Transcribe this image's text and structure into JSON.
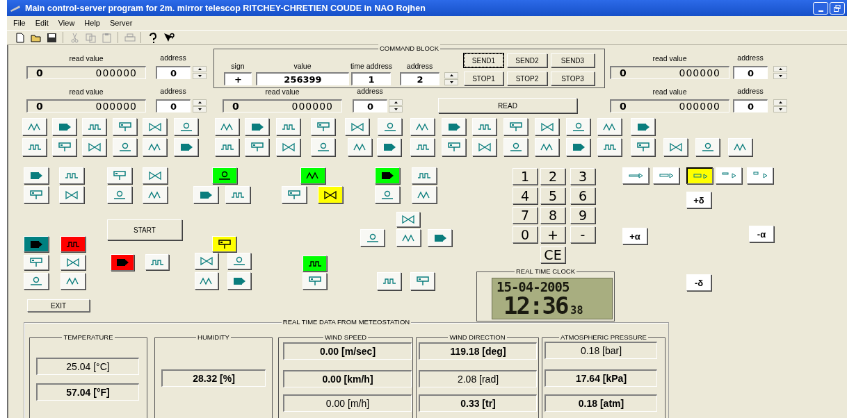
{
  "window": {
    "title": "Main control-server program for 2m. mirror telescop RITCHEY-CHRETIEN COUDE in NAO Rojhen"
  },
  "menu": [
    "File",
    "Edit",
    "View",
    "Help",
    "Server"
  ],
  "toolbar": [
    {
      "disabled": false
    },
    {
      "disabled": false
    },
    {
      "disabled": false
    },
    {
      "disabled": true
    },
    {
      "disabled": true
    },
    {
      "disabled": true
    },
    {
      "disabled": true
    },
    {
      "disabled": false
    },
    {
      "disabled": false
    }
  ],
  "readouts": [
    {
      "label": "read value",
      "sign": "0",
      "value": "000000",
      "address_label": "address",
      "address": "0"
    },
    {
      "label": "read value",
      "sign": "0",
      "value": "000000",
      "address_label": "address",
      "address": "0"
    },
    {
      "label": "read value",
      "sign": "0",
      "value": "000000",
      "address_label": "address",
      "address": "0"
    },
    {
      "label": "read value",
      "sign": "0",
      "value": "000000",
      "address_label": "address",
      "address": "0"
    },
    {
      "label": "read value",
      "sign": "0",
      "value": "000000",
      "address_label": "address",
      "address": "0"
    }
  ],
  "command_block": {
    "title": "COMMAND BLOCK",
    "sign_label": "sign",
    "sign": "+",
    "value_label": "value",
    "value": "256399",
    "time_address_label": "time address",
    "time_address": "1",
    "address_label": "address",
    "address": "2",
    "send_buttons": [
      {
        "label": "SEND1",
        "focused": true
      },
      {
        "label": "SEND2",
        "focused": false
      },
      {
        "label": "SEND3",
        "focused": false
      }
    ],
    "stop_buttons": [
      "STOP1",
      "STOP2",
      "STOP3"
    ]
  },
  "read_button": "READ",
  "highlighted_buttons": [
    {
      "color": "#00ff00"
    },
    {
      "color": "#00ff00"
    },
    {
      "color": "#00ff00"
    },
    {
      "color": "#ffff00"
    },
    {
      "color": "#008080"
    },
    {
      "color": "#ff0000"
    },
    {
      "color": "#ff0000"
    },
    {
      "color": "#ffff00"
    },
    {
      "color": "#00ff00"
    }
  ],
  "start_button": "START",
  "exit_button": "EXIT",
  "keypad": [
    "1",
    "2",
    "3",
    "4",
    "5",
    "6",
    "7",
    "8",
    "9",
    "0",
    "+",
    "-",
    "CE"
  ],
  "step_buttons": [
    {
      "selected": false
    },
    {
      "selected": false
    },
    {
      "selected": true
    },
    {
      "selected": false
    },
    {
      "selected": false
    }
  ],
  "adjust_buttons": [
    "+δ",
    "+α",
    "-α",
    "-δ"
  ],
  "clock": {
    "title": "REAL TIME CLOCK",
    "date": "15-04-2005",
    "time": "12:36",
    "seconds": "38"
  },
  "meteo": {
    "title": "REAL TIME DATA FROM METEOSTATION",
    "groups": [
      {
        "title": "TEMPERATURE",
        "values": [
          {
            "text": "25.04 [°C]",
            "bold": false
          },
          {
            "text": "57.04 [°F]",
            "bold": true
          }
        ]
      },
      {
        "title": "HUMIDITY",
        "values": [
          {
            "text": "28.32 [%]",
            "bold": true
          }
        ]
      },
      {
        "title": "WIND SPEED",
        "values": [
          {
            "text": "0.00 [m/sec]",
            "bold": true
          },
          {
            "text": "0.00 [km/h]",
            "bold": true
          },
          {
            "text": "0.00 [m/h]",
            "bold": false
          }
        ]
      },
      {
        "title": "WIND DIRECTION",
        "values": [
          {
            "text": "119.18 [deg]",
            "bold": true
          },
          {
            "text": "2.08 [rad]",
            "bold": false
          },
          {
            "text": "0.33 [tr]",
            "bold": true
          }
        ]
      },
      {
        "title": "ATMOSPHERIC PRESSURE",
        "values": [
          {
            "text": "0.18 [bar]",
            "bold": false
          },
          {
            "text": "17.64 [kPa]",
            "bold": true
          },
          {
            "text": "0.18 [atm]",
            "bold": true
          }
        ]
      }
    ]
  }
}
